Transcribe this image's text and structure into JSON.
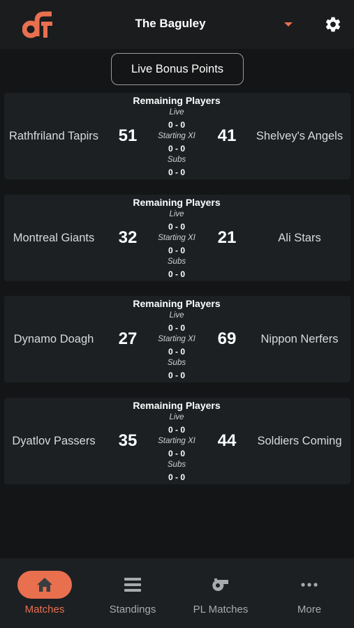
{
  "header": {
    "league_name": "The Baguley"
  },
  "bonus_button": {
    "label": "Live Bonus Points"
  },
  "matches": [
    {
      "home_team": "Rathfriland Tapirs",
      "home_score": "51",
      "away_team": "Shelvey's Angels",
      "away_score": "41",
      "remaining_title": "Remaining Players",
      "live_label": "Live",
      "live_value": "0 - 0",
      "starting_label": "Starting XI",
      "starting_value": "0 - 0",
      "subs_label": "Subs",
      "subs_value": "0 - 0"
    },
    {
      "home_team": "Montreal Giants",
      "home_score": "32",
      "away_team": "Ali Stars",
      "away_score": "21",
      "remaining_title": "Remaining Players",
      "live_label": "Live",
      "live_value": "0 - 0",
      "starting_label": "Starting XI",
      "starting_value": "0 - 0",
      "subs_label": "Subs",
      "subs_value": "0 - 0"
    },
    {
      "home_team": "Dynamo Doagh",
      "home_score": "27",
      "away_team": "Nippon Nerfers",
      "away_score": "69",
      "remaining_title": "Remaining Players",
      "live_label": "Live",
      "live_value": "0 - 0",
      "starting_label": "Starting XI",
      "starting_value": "0 - 0",
      "subs_label": "Subs",
      "subs_value": "0 - 0"
    },
    {
      "home_team": "Dyatlov Passers",
      "home_score": "35",
      "away_team": "Soldiers Coming",
      "away_score": "44",
      "remaining_title": "Remaining Players",
      "live_label": "Live",
      "live_value": "0 - 0",
      "starting_label": "Starting XI",
      "starting_value": "0 - 0",
      "subs_label": "Subs",
      "subs_value": "0 - 0"
    }
  ],
  "nav": {
    "items": [
      {
        "label": "Matches",
        "icon": "home-icon",
        "active": true
      },
      {
        "label": "Standings",
        "icon": "list-icon",
        "active": false
      },
      {
        "label": "PL Matches",
        "icon": "whistle-icon",
        "active": false
      },
      {
        "label": "More",
        "icon": "more-dots-icon",
        "active": false
      }
    ]
  },
  "colors": {
    "accent": "#e8704f",
    "background": "#141516",
    "card": "#1c2023",
    "nav_background": "#1d2023"
  }
}
